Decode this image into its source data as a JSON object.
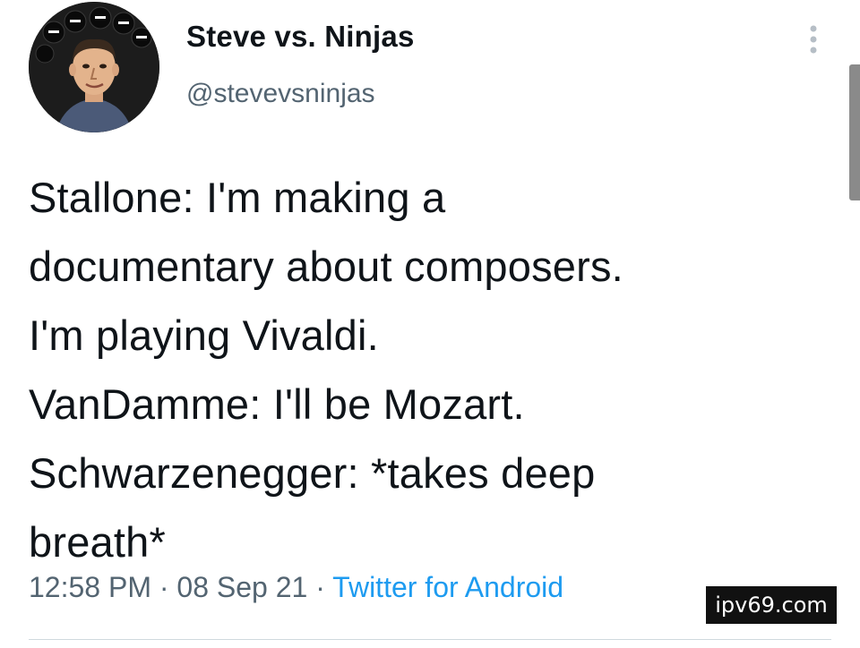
{
  "profile": {
    "display_name": "Steve vs. Ninjas",
    "handle": "@stevevsninjas",
    "avatar_icon": "ninja-face-avatar"
  },
  "header": {
    "more_icon": "vertical-ellipsis-icon"
  },
  "tweet": {
    "text": "Stallone: I'm making a\ndocumentary about composers.\nI'm playing Vivaldi.\nVanDamme: I'll be Mozart.\nSchwarzenegger: *takes deep\nbreath*",
    "time": "12:58 PM",
    "separator": "·",
    "date": "08 Sep 21",
    "source": "Twitter for Android"
  },
  "watermark": {
    "text": "ipv69.com"
  },
  "colors": {
    "text_primary": "#0f1419",
    "text_secondary": "#536471",
    "link": "#1d9bf0",
    "divider": "#cfd9de"
  }
}
